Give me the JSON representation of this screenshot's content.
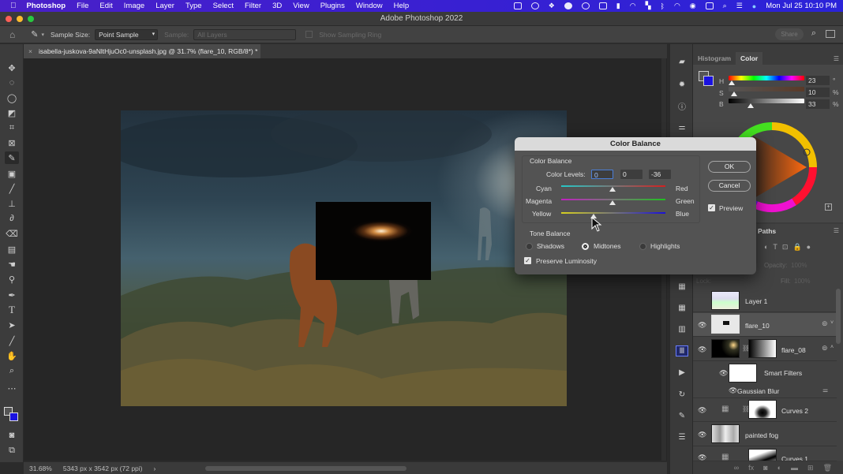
{
  "menubar": {
    "app": "Photoshop",
    "items": [
      "File",
      "Edit",
      "Image",
      "Layer",
      "Type",
      "Select",
      "Filter",
      "3D",
      "View",
      "Plugins",
      "Window",
      "Help"
    ],
    "clock": "Mon Jul 25  10:10 PM"
  },
  "window": {
    "title": "Adobe Photoshop 2022"
  },
  "options": {
    "sample_size_label": "Sample Size:",
    "sample_size_value": "Point Sample",
    "sample_label": "Sample:",
    "sample_value": "All Layers",
    "sampling_ring_label": "Show Sampling Ring",
    "share_label": "Share"
  },
  "document": {
    "tab_title": "isabella-juskova-9aNltHjuOc0-unsplash.jpg @ 31.7% (flare_10, RGB/8*) *"
  },
  "status": {
    "zoom": "31.68%",
    "dimensions": "5343 px x 3542 px (72 ppi)"
  },
  "color_panel": {
    "tabs": [
      "Histogram",
      "Color"
    ],
    "active_tab": "Color",
    "h_label": "H",
    "s_label": "S",
    "b_label": "B",
    "h_value": "23",
    "s_value": "10",
    "b_value": "33",
    "h_unit": "°",
    "s_unit": "%",
    "b_unit": "%",
    "foreground": "#555555",
    "background": "#1a12e0"
  },
  "layers_panel": {
    "tab": "Paths",
    "opacity_label": "Opacity:",
    "opacity_value": "100%",
    "lock_label": "Lock:",
    "fill_label": "Fill:",
    "fill_value": "100%",
    "layers": [
      {
        "name": "Layer 1",
        "visible": false
      },
      {
        "name": "flare_10",
        "visible": true,
        "selected": true
      },
      {
        "name": "flare_08",
        "visible": true
      },
      {
        "name": "Smart Filters",
        "visible": true
      },
      {
        "name": "Gaussian Blur",
        "visible": true
      },
      {
        "name": "Curves 2",
        "visible": true
      },
      {
        "name": "painted fog",
        "visible": true
      },
      {
        "name": "Curves 1",
        "visible": true
      }
    ]
  },
  "dialog": {
    "title": "Color Balance",
    "section1": "Color Balance",
    "color_levels_label": "Color Levels:",
    "levels": [
      "0",
      "0",
      "-36"
    ],
    "sliders": [
      {
        "left": "Cyan",
        "right": "Red",
        "value": 0
      },
      {
        "left": "Magenta",
        "right": "Green",
        "value": 0
      },
      {
        "left": "Yellow",
        "right": "Blue",
        "value": -36
      }
    ],
    "section2": "Tone Balance",
    "tones": [
      "Shadows",
      "Midtones",
      "Highlights"
    ],
    "selected_tone": "Midtones",
    "preserve_label": "Preserve Luminosity",
    "preserve_checked": true,
    "ok_label": "OK",
    "cancel_label": "Cancel",
    "preview_label": "Preview",
    "preview_checked": true
  }
}
